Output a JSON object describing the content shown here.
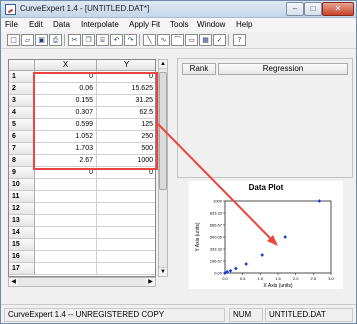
{
  "window": {
    "title": "CurveExpert 1.4 - [UNTITLED.DAT*]",
    "controls": {
      "minimize": "–",
      "maximize": "□",
      "close": "✕"
    }
  },
  "menu": [
    "File",
    "Edit",
    "Data",
    "Interpolate",
    "Apply Fit",
    "Tools",
    "Window",
    "Help"
  ],
  "toolbar": {
    "icons": [
      "new-file-icon",
      "open-folder-icon",
      "save-icon",
      "print-icon",
      "cut-icon",
      "copy-icon",
      "paste-icon",
      "undo-icon",
      "redo-icon",
      "linear-fit-icon",
      "quadratic-fit-icon",
      "curve-fit-icon",
      "data-plot-icon",
      "table-icon",
      "check-icon",
      "help-icon"
    ],
    "glyphs": [
      "□",
      "▱",
      "▣",
      "⎙",
      "✂",
      "❐",
      "⌸",
      "↶",
      "↷",
      "╲",
      "∿",
      "⌒",
      "▭",
      "▦",
      "✓",
      "?"
    ]
  },
  "grid": {
    "columns": [
      "X",
      "Y"
    ],
    "rows": [
      {
        "n": "1",
        "x": "0",
        "y": "0"
      },
      {
        "n": "2",
        "x": "0.06",
        "y": "15.625"
      },
      {
        "n": "3",
        "x": "0.155",
        "y": "31.25"
      },
      {
        "n": "4",
        "x": "0.307",
        "y": "62.5"
      },
      {
        "n": "5",
        "x": "0.599",
        "y": "125"
      },
      {
        "n": "6",
        "x": "1.052",
        "y": "250"
      },
      {
        "n": "7",
        "x": "1.703",
        "y": "500"
      },
      {
        "n": "8",
        "x": "2.67",
        "y": "1000"
      },
      {
        "n": "9",
        "x": "0",
        "y": "0"
      },
      {
        "n": "10",
        "x": "",
        "y": ""
      },
      {
        "n": "11",
        "x": "",
        "y": ""
      },
      {
        "n": "12",
        "x": "",
        "y": ""
      },
      {
        "n": "13",
        "x": "",
        "y": ""
      },
      {
        "n": "14",
        "x": "",
        "y": ""
      },
      {
        "n": "15",
        "x": "",
        "y": ""
      },
      {
        "n": "16",
        "x": "",
        "y": ""
      },
      {
        "n": "17",
        "x": "",
        "y": ""
      }
    ]
  },
  "rank_panel": {
    "rank_label": "Rank",
    "regression_label": "Regression"
  },
  "plot": {
    "title": "Data Plot",
    "xlabel": "X Axis (units)",
    "ylabel": "Y Axis (units)",
    "x_ticks": [
      "0.0",
      "0.5",
      "1.0",
      "1.5",
      "2.0",
      "2.5",
      "3.0"
    ],
    "y_ticks": [
      "0.00",
      "166.67",
      "333.33",
      "500.00",
      "666.67",
      "833.33",
      "1000"
    ],
    "marker_color": "#1a3ccc",
    "annotation_color": "#e8463e"
  },
  "chart_data": {
    "type": "scatter",
    "title": "Data Plot",
    "xlabel": "X Axis (units)",
    "ylabel": "Y Axis (units)",
    "x": [
      0,
      0.06,
      0.155,
      0.307,
      0.599,
      1.052,
      1.703,
      2.67
    ],
    "y": [
      0,
      15.625,
      31.25,
      62.5,
      125,
      250,
      500,
      1000
    ],
    "xlim": [
      0,
      3.0
    ],
    "ylim": [
      0,
      1000
    ]
  },
  "status": {
    "message": "CurveExpert 1.4 -- UNREGISTERED COPY",
    "num": "NUM",
    "file": "UNTITLED.DAT"
  }
}
